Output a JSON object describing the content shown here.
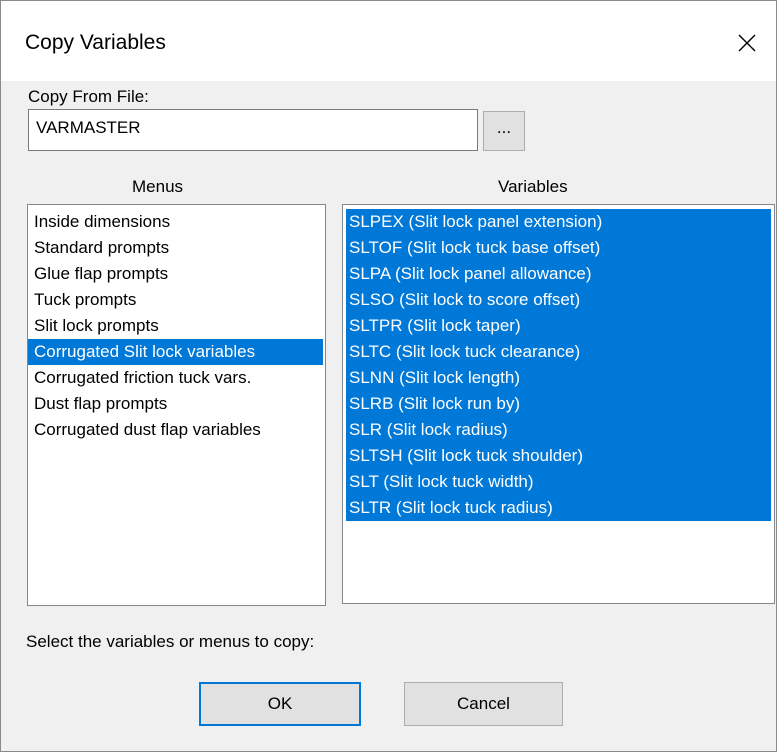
{
  "window": {
    "title": "Copy Variables"
  },
  "file": {
    "label": "Copy From File:",
    "value": "VARMASTER",
    "browse_label": "..."
  },
  "menus": {
    "header": "Menus",
    "items": [
      "Inside dimensions",
      "Standard prompts",
      "Glue flap prompts",
      "Tuck prompts",
      "Slit lock prompts",
      "Corrugated Slit lock variables",
      "Corrugated friction tuck vars.",
      "Dust flap prompts",
      "Corrugated dust flap variables"
    ],
    "selected_index": 5
  },
  "variables": {
    "header": "Variables",
    "items": [
      "SLPEX (Slit lock panel extension)",
      "SLTOF (Slit lock tuck base offset)",
      "SLPA (Slit lock panel allowance)",
      "SLSO (Slit lock to score offset)",
      "SLTPR (Slit lock taper)",
      "SLTC (Slit lock tuck clearance)",
      "SLNN (Slit lock length)",
      "SLRB (Slit lock run by)",
      "SLR (Slit lock radius)",
      "SLTSH (Slit lock tuck shoulder)",
      "SLT (Slit lock tuck width)",
      "SLTR (Slit lock tuck radius)"
    ]
  },
  "instruction": "Select the variables or menus to copy:",
  "buttons": {
    "ok": "OK",
    "cancel": "Cancel"
  },
  "colors": {
    "selection": "#0078d7",
    "dialog_bg": "#f0f0f0"
  }
}
